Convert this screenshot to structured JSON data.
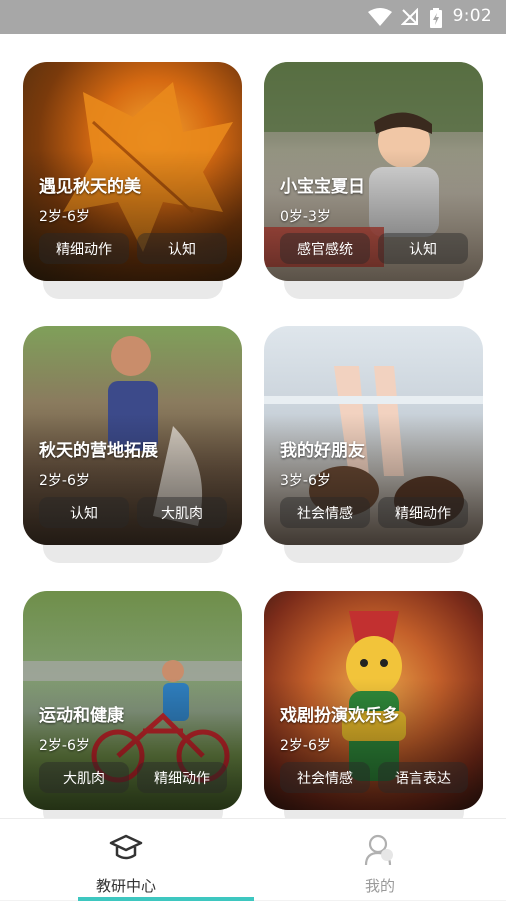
{
  "status_bar": {
    "time": "9:02"
  },
  "cards": [
    {
      "title": "遇见秋天的美",
      "age": "2岁-6岁",
      "tags": [
        "精细动作",
        "认知"
      ]
    },
    {
      "title": "小宝宝夏日",
      "age": "0岁-3岁",
      "tags": [
        "感官感统",
        "认知"
      ]
    },
    {
      "title": "秋天的营地拓展",
      "age": "2岁-6岁",
      "tags": [
        "认知",
        "大肌肉"
      ]
    },
    {
      "title": "我的好朋友",
      "age": "3岁-6岁",
      "tags": [
        "社会情感",
        "精细动作"
      ]
    },
    {
      "title": "运动和健康",
      "age": "2岁-6岁",
      "tags": [
        "大肌肉",
        "精细动作"
      ]
    },
    {
      "title": "戏剧扮演欢乐多",
      "age": "2岁-6岁",
      "tags": [
        "社会情感",
        "语言表达"
      ]
    }
  ],
  "tabbar": {
    "items": [
      {
        "label": "教研中心",
        "icon": "graduation-cap-icon",
        "active": true
      },
      {
        "label": "我的",
        "icon": "person-icon",
        "active": false
      }
    ]
  },
  "colors": {
    "accent": "#3ec7c0",
    "status_bar": "#a7a7a7"
  }
}
